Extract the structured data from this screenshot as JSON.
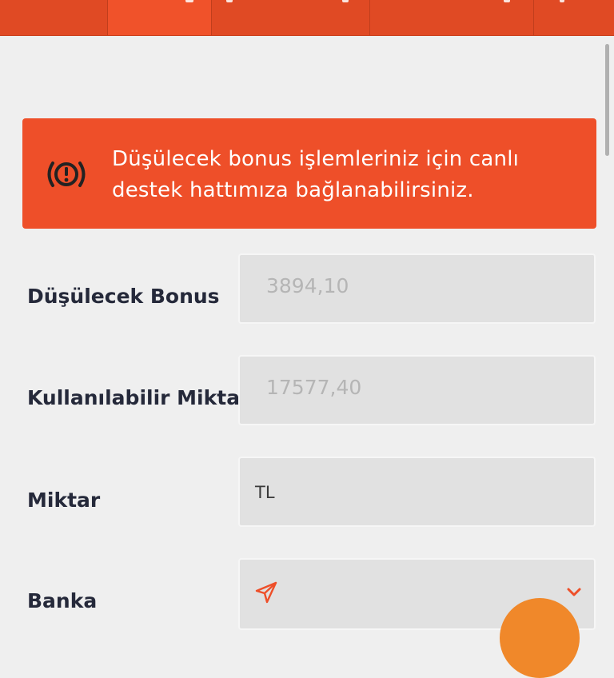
{
  "alert": {
    "icon": "alert-circle-icon",
    "message_line1": "Düşülecek bonus işlemleriniz için canlı",
    "message_line2": "destek hattımıza bağlanabilirsiniz."
  },
  "form": {
    "bonus": {
      "label": "Düşülecek Bonus",
      "value": "3894,10"
    },
    "available": {
      "label": "Kullanılabilir Miktar",
      "value": "17577,40"
    },
    "amount": {
      "label": "Miktar",
      "value": "TL"
    },
    "bank": {
      "label": "Banka",
      "icon": "send-icon",
      "dropdown_icon": "chevron-down-icon"
    }
  },
  "colors": {
    "accent": "#ee4f29",
    "label": "#25293a",
    "field_bg": "#e1e1e1",
    "fab": "#f0882a"
  }
}
